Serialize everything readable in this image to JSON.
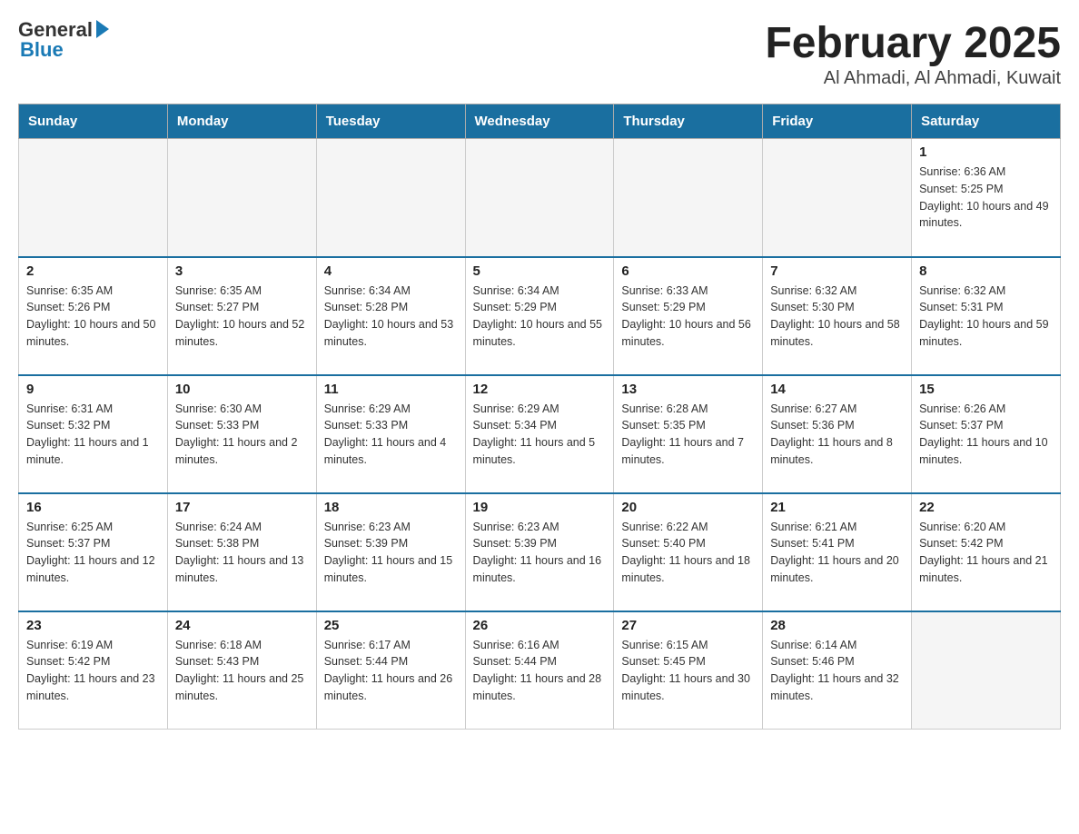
{
  "logo": {
    "general": "General",
    "blue": "Blue"
  },
  "title": "February 2025",
  "subtitle": "Al Ahmadi, Al Ahmadi, Kuwait",
  "days_of_week": [
    "Sunday",
    "Monday",
    "Tuesday",
    "Wednesday",
    "Thursday",
    "Friday",
    "Saturday"
  ],
  "weeks": [
    [
      {
        "day": "",
        "info": ""
      },
      {
        "day": "",
        "info": ""
      },
      {
        "day": "",
        "info": ""
      },
      {
        "day": "",
        "info": ""
      },
      {
        "day": "",
        "info": ""
      },
      {
        "day": "",
        "info": ""
      },
      {
        "day": "1",
        "info": "Sunrise: 6:36 AM\nSunset: 5:25 PM\nDaylight: 10 hours and 49 minutes."
      }
    ],
    [
      {
        "day": "2",
        "info": "Sunrise: 6:35 AM\nSunset: 5:26 PM\nDaylight: 10 hours and 50 minutes."
      },
      {
        "day": "3",
        "info": "Sunrise: 6:35 AM\nSunset: 5:27 PM\nDaylight: 10 hours and 52 minutes."
      },
      {
        "day": "4",
        "info": "Sunrise: 6:34 AM\nSunset: 5:28 PM\nDaylight: 10 hours and 53 minutes."
      },
      {
        "day": "5",
        "info": "Sunrise: 6:34 AM\nSunset: 5:29 PM\nDaylight: 10 hours and 55 minutes."
      },
      {
        "day": "6",
        "info": "Sunrise: 6:33 AM\nSunset: 5:29 PM\nDaylight: 10 hours and 56 minutes."
      },
      {
        "day": "7",
        "info": "Sunrise: 6:32 AM\nSunset: 5:30 PM\nDaylight: 10 hours and 58 minutes."
      },
      {
        "day": "8",
        "info": "Sunrise: 6:32 AM\nSunset: 5:31 PM\nDaylight: 10 hours and 59 minutes."
      }
    ],
    [
      {
        "day": "9",
        "info": "Sunrise: 6:31 AM\nSunset: 5:32 PM\nDaylight: 11 hours and 1 minute."
      },
      {
        "day": "10",
        "info": "Sunrise: 6:30 AM\nSunset: 5:33 PM\nDaylight: 11 hours and 2 minutes."
      },
      {
        "day": "11",
        "info": "Sunrise: 6:29 AM\nSunset: 5:33 PM\nDaylight: 11 hours and 4 minutes."
      },
      {
        "day": "12",
        "info": "Sunrise: 6:29 AM\nSunset: 5:34 PM\nDaylight: 11 hours and 5 minutes."
      },
      {
        "day": "13",
        "info": "Sunrise: 6:28 AM\nSunset: 5:35 PM\nDaylight: 11 hours and 7 minutes."
      },
      {
        "day": "14",
        "info": "Sunrise: 6:27 AM\nSunset: 5:36 PM\nDaylight: 11 hours and 8 minutes."
      },
      {
        "day": "15",
        "info": "Sunrise: 6:26 AM\nSunset: 5:37 PM\nDaylight: 11 hours and 10 minutes."
      }
    ],
    [
      {
        "day": "16",
        "info": "Sunrise: 6:25 AM\nSunset: 5:37 PM\nDaylight: 11 hours and 12 minutes."
      },
      {
        "day": "17",
        "info": "Sunrise: 6:24 AM\nSunset: 5:38 PM\nDaylight: 11 hours and 13 minutes."
      },
      {
        "day": "18",
        "info": "Sunrise: 6:23 AM\nSunset: 5:39 PM\nDaylight: 11 hours and 15 minutes."
      },
      {
        "day": "19",
        "info": "Sunrise: 6:23 AM\nSunset: 5:39 PM\nDaylight: 11 hours and 16 minutes."
      },
      {
        "day": "20",
        "info": "Sunrise: 6:22 AM\nSunset: 5:40 PM\nDaylight: 11 hours and 18 minutes."
      },
      {
        "day": "21",
        "info": "Sunrise: 6:21 AM\nSunset: 5:41 PM\nDaylight: 11 hours and 20 minutes."
      },
      {
        "day": "22",
        "info": "Sunrise: 6:20 AM\nSunset: 5:42 PM\nDaylight: 11 hours and 21 minutes."
      }
    ],
    [
      {
        "day": "23",
        "info": "Sunrise: 6:19 AM\nSunset: 5:42 PM\nDaylight: 11 hours and 23 minutes."
      },
      {
        "day": "24",
        "info": "Sunrise: 6:18 AM\nSunset: 5:43 PM\nDaylight: 11 hours and 25 minutes."
      },
      {
        "day": "25",
        "info": "Sunrise: 6:17 AM\nSunset: 5:44 PM\nDaylight: 11 hours and 26 minutes."
      },
      {
        "day": "26",
        "info": "Sunrise: 6:16 AM\nSunset: 5:44 PM\nDaylight: 11 hours and 28 minutes."
      },
      {
        "day": "27",
        "info": "Sunrise: 6:15 AM\nSunset: 5:45 PM\nDaylight: 11 hours and 30 minutes."
      },
      {
        "day": "28",
        "info": "Sunrise: 6:14 AM\nSunset: 5:46 PM\nDaylight: 11 hours and 32 minutes."
      },
      {
        "day": "",
        "info": ""
      }
    ]
  ]
}
